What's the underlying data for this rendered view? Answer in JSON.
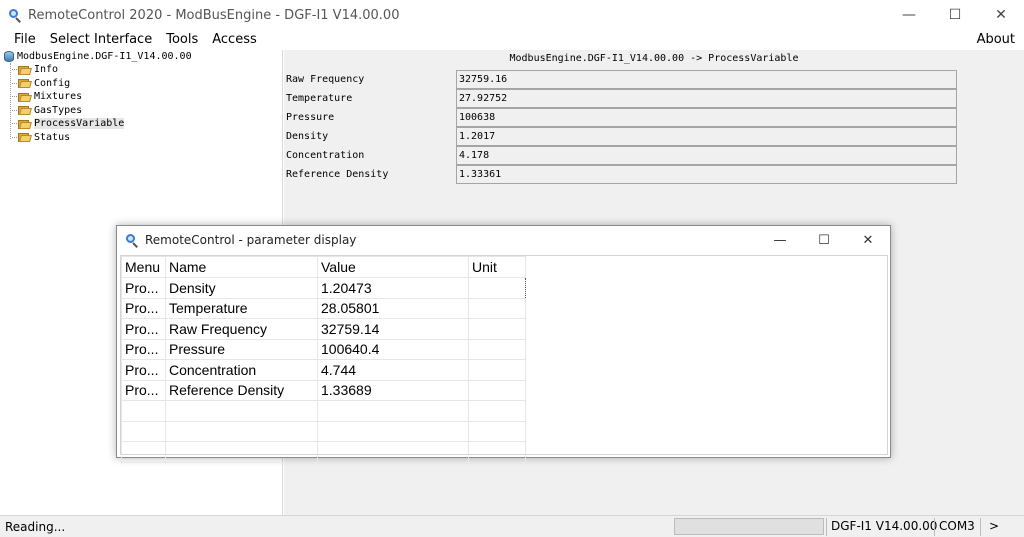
{
  "window": {
    "title": "RemoteControl 2020 - ModBusEngine - DGF-I1  V14.00.00",
    "minimize": "—",
    "maximize": "☐",
    "close": "✕"
  },
  "menubar": {
    "items": [
      "File",
      "Select Interface",
      "Tools",
      "Access"
    ],
    "about": "About"
  },
  "tree": {
    "root": "ModbusEngine.DGF-I1_V14.00.00",
    "children": [
      "Info",
      "Config",
      "Mixtures",
      "GasTypes",
      "ProcessVariable",
      "Status"
    ],
    "selected": "ProcessVariable"
  },
  "main": {
    "path": "ModbusEngine.DGF-I1_V14.00.00 -> ProcessVariable",
    "rows": [
      {
        "name": "Raw Frequency",
        "value": "32759.16"
      },
      {
        "name": "Temperature",
        "value": "27.92752"
      },
      {
        "name": "Pressure",
        "value": "100638"
      },
      {
        "name": "Density",
        "value": "1.2017"
      },
      {
        "name": "Concentration",
        "value": "4.178"
      },
      {
        "name": "Reference Density",
        "value": "1.33361"
      }
    ]
  },
  "dialog": {
    "title": "RemoteControl - parameter display",
    "minimize": "—",
    "maximize": "☐",
    "close": "✕",
    "columns": [
      "Menu",
      "Name",
      "Value",
      "Unit"
    ],
    "rows": [
      {
        "menu": "Pro...",
        "name": "Density",
        "value": "1.20473",
        "unit": ""
      },
      {
        "menu": "Pro...",
        "name": "Temperature",
        "value": "28.05801",
        "unit": ""
      },
      {
        "menu": "Pro...",
        "name": "Raw Frequency",
        "value": "32759.14",
        "unit": ""
      },
      {
        "menu": "Pro...",
        "name": "Pressure",
        "value": "100640.4",
        "unit": ""
      },
      {
        "menu": "Pro...",
        "name": "Concentration",
        "value": "4.744",
        "unit": ""
      },
      {
        "menu": "Pro...",
        "name": "Reference Density",
        "value": "1.33689",
        "unit": ""
      }
    ]
  },
  "statusbar": {
    "status": "Reading...",
    "progress": 0,
    "device": "DGF-I1  V14.00.00",
    "port": "COM3",
    "more": ">"
  },
  "colors": {
    "main_bg": "#f0f0f0",
    "selection": "#e6e6e6",
    "icon_blue": "#3a7bd5",
    "folder": "#f4cf6a"
  }
}
